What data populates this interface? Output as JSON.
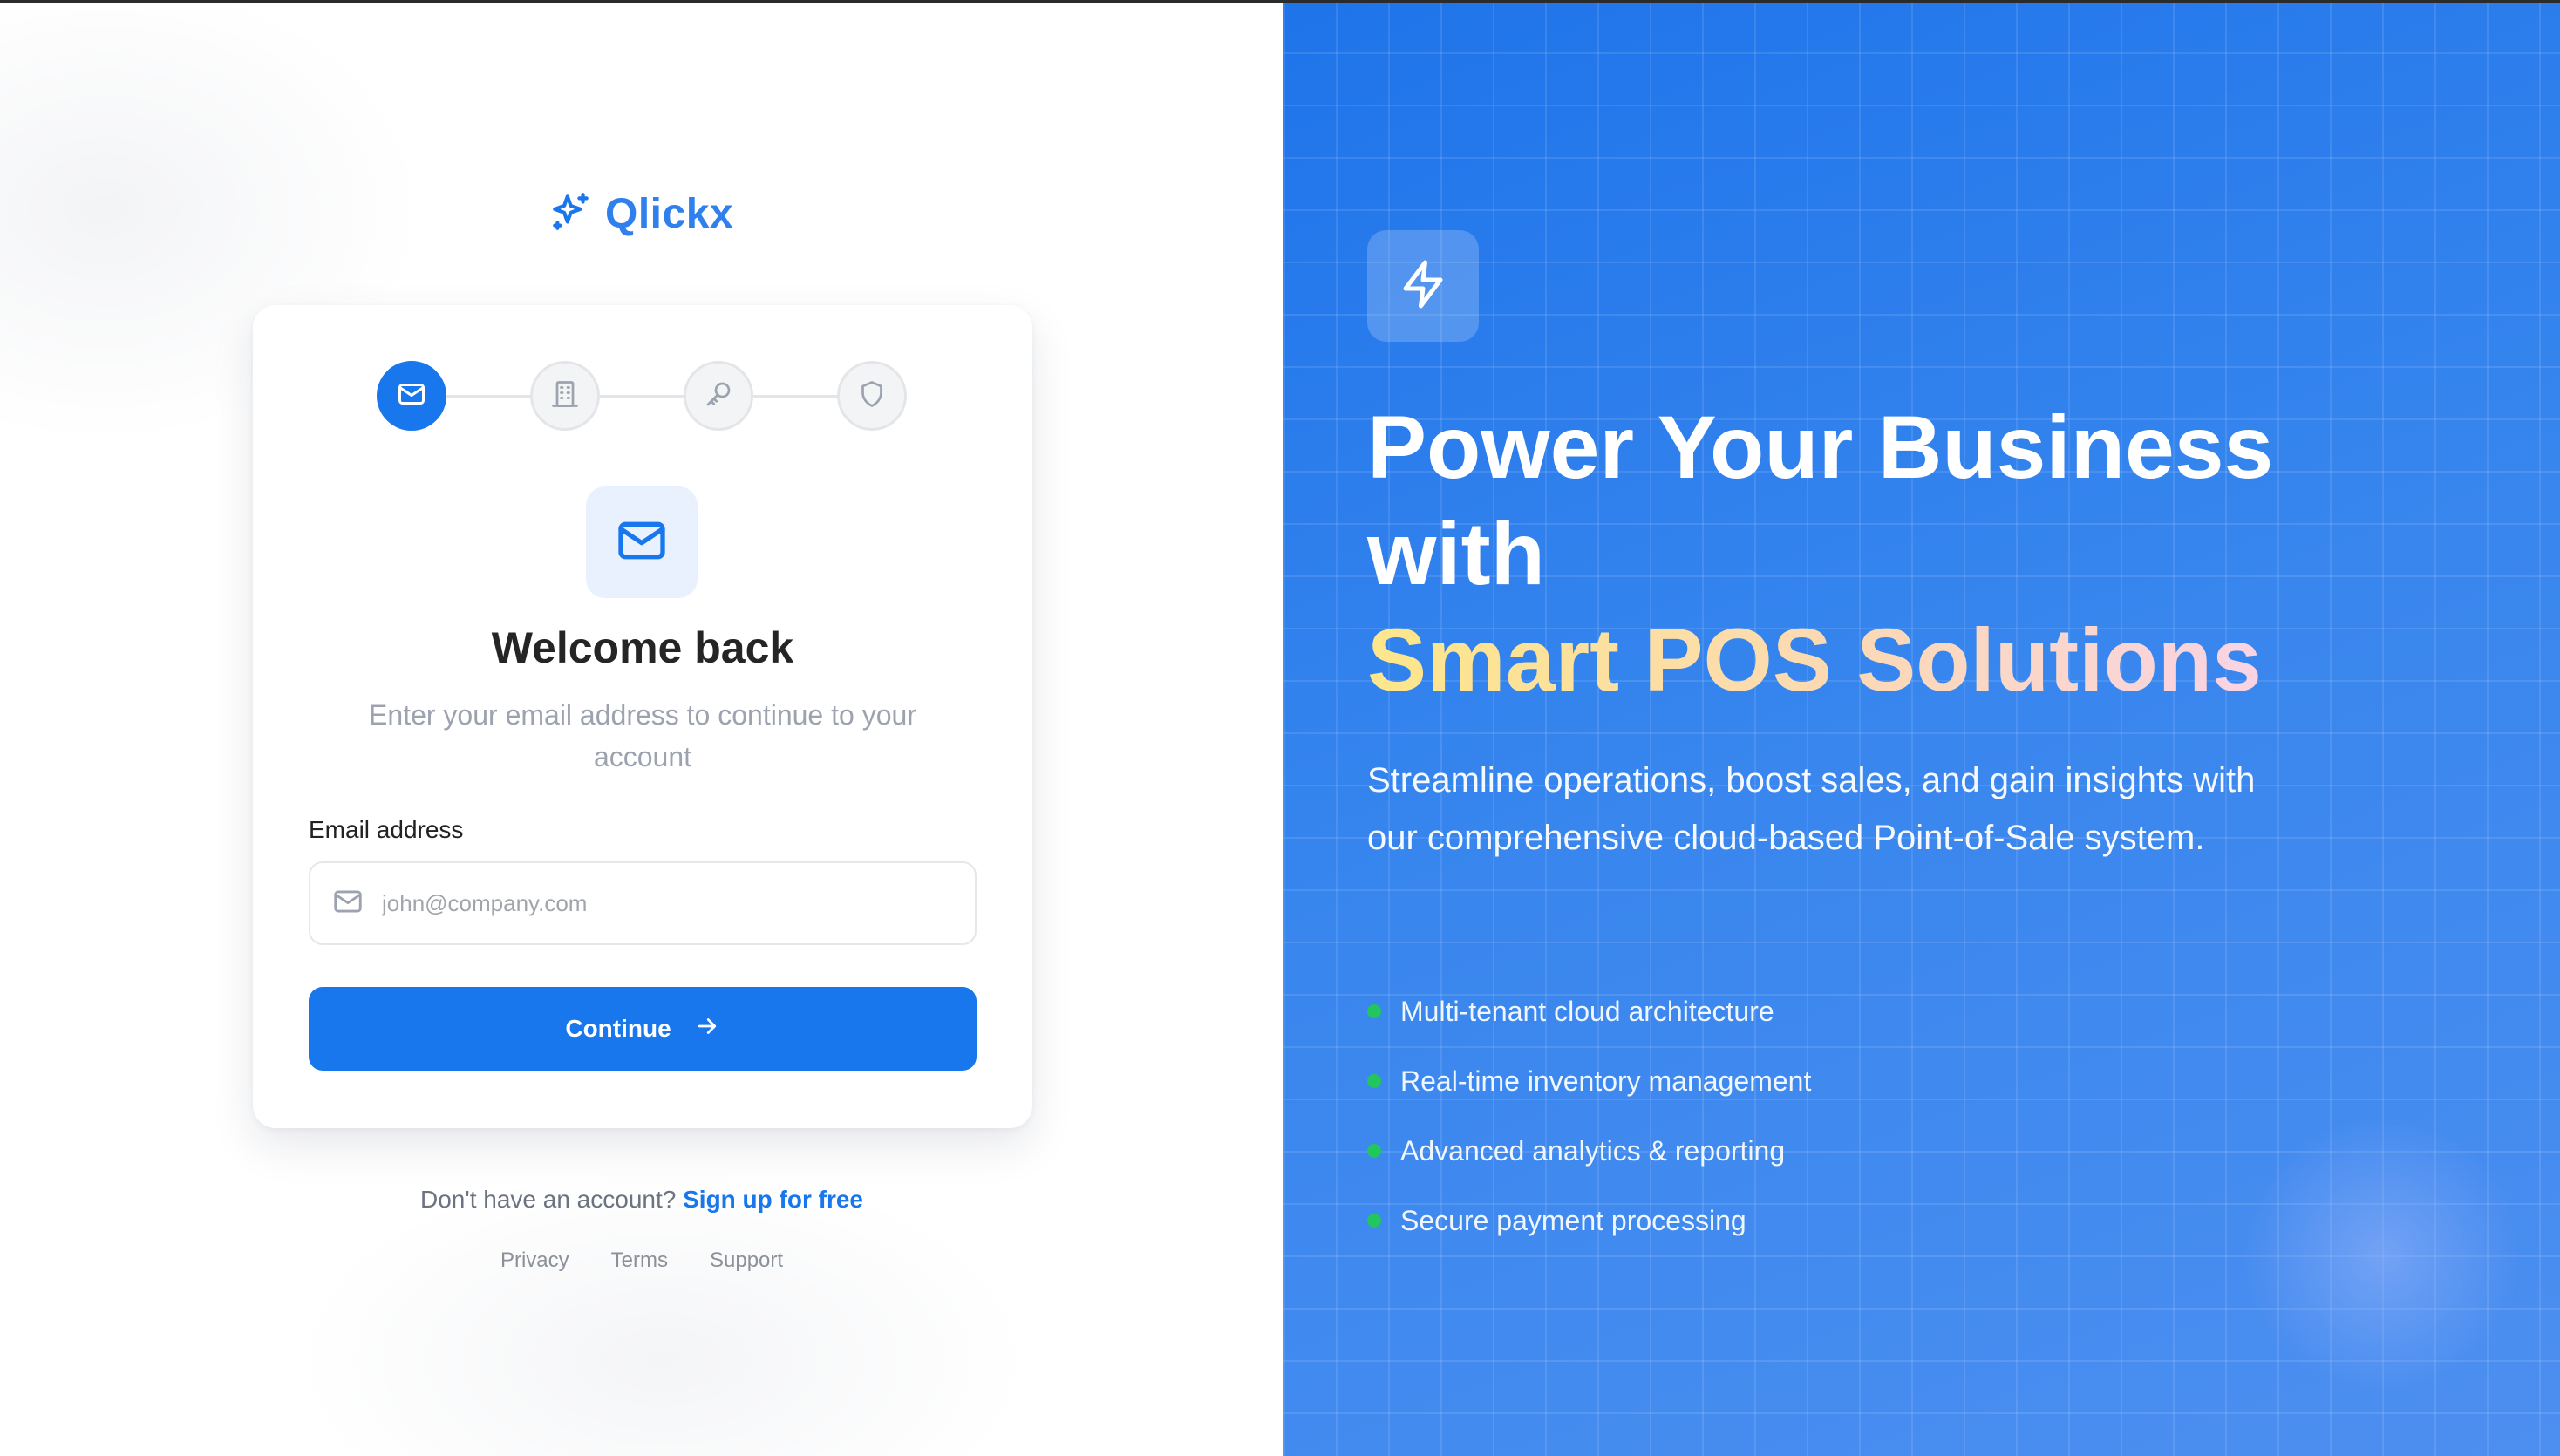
{
  "brand": {
    "name": "Qlickx",
    "logo_icon": "sparkles-icon"
  },
  "steps": [
    {
      "icon": "mail-icon",
      "state": "active"
    },
    {
      "icon": "building-icon",
      "state": "pending"
    },
    {
      "icon": "key-icon",
      "state": "pending"
    },
    {
      "icon": "shield-icon",
      "state": "pending"
    }
  ],
  "login": {
    "hero_icon": "mail-icon",
    "title": "Welcome back",
    "subtitle": "Enter your email address to continue to your account",
    "email_label": "Email address",
    "email_placeholder": "john@company.com",
    "email_value": "",
    "continue_label": "Continue"
  },
  "signup": {
    "prompt": "Don't have an account?",
    "link": "Sign up for free"
  },
  "footer": {
    "privacy": "Privacy",
    "terms": "Terms",
    "support": "Support"
  },
  "promo": {
    "icon": "lightning-bolt-icon",
    "headline_line1": "Power Your Business",
    "headline_line2": "with",
    "headline_accent": "Smart POS Solutions",
    "description": "Streamline operations, boost sales, and gain insights with our comprehensive cloud-based Point-of-Sale system.",
    "features": [
      "Multi-tenant cloud architecture",
      "Real-time inventory management",
      "Advanced analytics & reporting",
      "Secure payment processing"
    ]
  },
  "colors": {
    "primary": "#1877ec",
    "brand_text": "#2f80ed",
    "feature_dot": "#22c55e",
    "accent_gradient_start": "#fde68a",
    "accent_gradient_end": "#f9d3e6"
  }
}
